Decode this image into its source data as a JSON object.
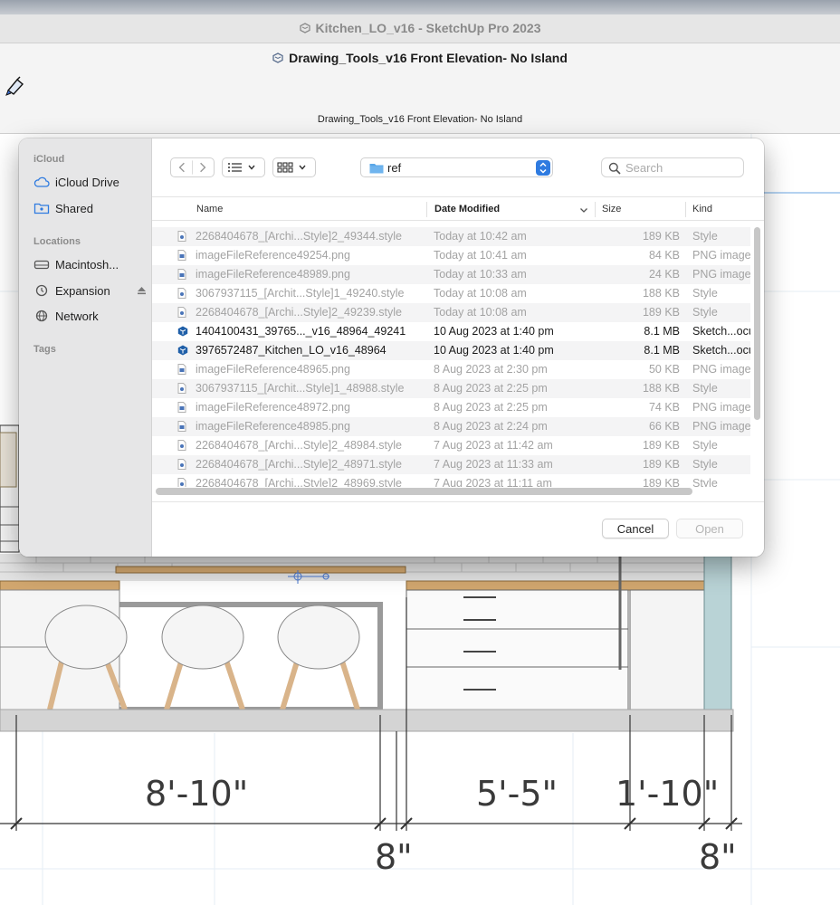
{
  "app_window": {
    "title": "Kitchen_LO_v16 - SketchUp Pro 2023"
  },
  "document": {
    "title": "Drawing_Tools_v16 Front Elevation- No Island",
    "page_label": "Drawing_Tools_v16 Front Elevation- No Island"
  },
  "dialog": {
    "sidebar": {
      "sections": [
        {
          "label": "iCloud",
          "items": [
            {
              "label": "iCloud Drive",
              "icon": "cloud-icon"
            },
            {
              "label": "Shared",
              "icon": "shared-folder-icon"
            }
          ]
        },
        {
          "label": "Locations",
          "items": [
            {
              "label": "Macintosh...",
              "icon": "hard-drive-icon"
            },
            {
              "label": "Expansion",
              "icon": "time-machine-icon"
            },
            {
              "label": "Network",
              "icon": "globe-icon"
            }
          ]
        },
        {
          "label": "Tags",
          "items": []
        }
      ]
    },
    "toolbar": {
      "path": "ref",
      "search_placeholder": "Search"
    },
    "columns": {
      "name": "Name",
      "date": "Date Modified",
      "size": "Size",
      "kind": "Kind"
    },
    "files": [
      {
        "name": "2268404678_[Archi...Style]2_49344.style",
        "date": "Today at 10:42 am",
        "size": "189 KB",
        "kind": "Style"
      },
      {
        "name": "imageFileReference49254.png",
        "date": "Today at 10:41 am",
        "size": "84 KB",
        "kind": "PNG image"
      },
      {
        "name": "imageFileReference48989.png",
        "date": "Today at 10:33 am",
        "size": "24 KB",
        "kind": "PNG image"
      },
      {
        "name": "3067937115_[Archit...Style]1_49240.style",
        "date": "Today at 10:08 am",
        "size": "188 KB",
        "kind": "Style"
      },
      {
        "name": "2268404678_[Archi...Style]2_49239.style",
        "date": "Today at 10:08 am",
        "size": "189 KB",
        "kind": "Style"
      },
      {
        "name": "1404100431_39765..._v16_48964_49241",
        "date": "10 Aug 2023 at 1:40 pm",
        "size": "8.1 MB",
        "kind": "Sketch...ocument"
      },
      {
        "name": "3976572487_Kitchen_LO_v16_48964",
        "date": "10 Aug 2023 at 1:40 pm",
        "size": "8.1 MB",
        "kind": "Sketch...ocument"
      },
      {
        "name": "imageFileReference48965.png",
        "date": "8 Aug 2023 at 2:30 pm",
        "size": "50 KB",
        "kind": "PNG image"
      },
      {
        "name": "3067937115_[Archit...Style]1_48988.style",
        "date": "8 Aug 2023 at 2:25 pm",
        "size": "188 KB",
        "kind": "Style"
      },
      {
        "name": "imageFileReference48972.png",
        "date": "8 Aug 2023 at 2:25 pm",
        "size": "74 KB",
        "kind": "PNG image"
      },
      {
        "name": "imageFileReference48985.png",
        "date": "8 Aug 2023 at 2:24 pm",
        "size": "66 KB",
        "kind": "PNG image"
      },
      {
        "name": "2268404678_[Archi...Style]2_48984.style",
        "date": "7 Aug 2023 at 11:42 am",
        "size": "189 KB",
        "kind": "Style"
      },
      {
        "name": "2268404678_[Archi...Style]2_48971.style",
        "date": "7 Aug 2023 at 11:33 am",
        "size": "189 KB",
        "kind": "Style"
      },
      {
        "name": "2268404678_[Archi...Style]2_48969.style",
        "date": "7 Aug 2023 at 11:11 am",
        "size": "189 KB",
        "kind": "Style"
      }
    ],
    "buttons": {
      "cancel": "Cancel",
      "open": "Open"
    }
  },
  "dimensions": {
    "d1": "8'-10\"",
    "d2": "5'-5\"",
    "d3": "1'-10\"",
    "d4": "8\"",
    "d5": "8\""
  },
  "colors": {
    "accent": "#2f7be0",
    "folder": "#5aa7e8",
    "countertop": "#d2a76f",
    "backsplash": "#e3e3e3"
  }
}
